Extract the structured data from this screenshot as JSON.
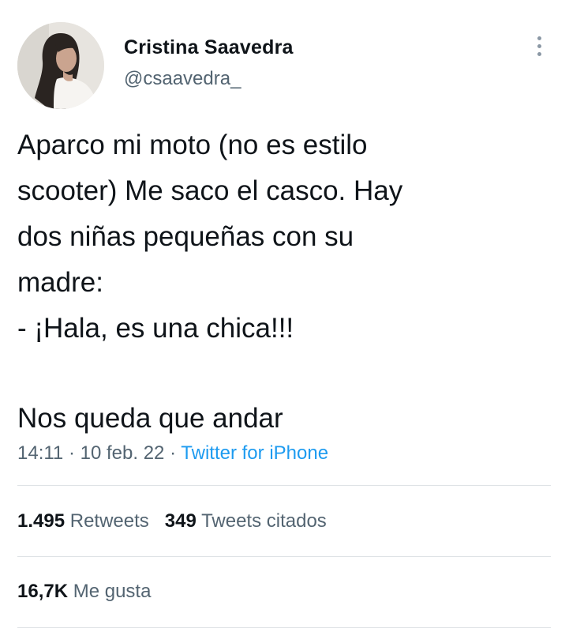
{
  "author": {
    "display_name": "Cristina Saavedra",
    "handle": "@csaavedra_"
  },
  "icons": {
    "avatar": "profile-photo",
    "more": "more-vertical-icon"
  },
  "tweet": {
    "lines": [
      "Aparco mi moto (no es estilo",
      "scooter) Me saco el casco. Hay",
      "dos niñas pequeñas con su",
      "madre:",
      "- ¡Hala, es una chica!!!",
      "Nos queda que andar"
    ]
  },
  "meta": {
    "time": "14:11",
    "separator": "·",
    "date": "10 feb. 22",
    "source": "Twitter for iPhone"
  },
  "stats": {
    "retweets_count": "1.495",
    "retweets_label": "Retweets",
    "quotes_count": "349",
    "quotes_label": "Tweets citados",
    "likes_count": "16,7K",
    "likes_label": "Me gusta"
  },
  "colors": {
    "text": "#0f1419",
    "secondary": "#536471",
    "link": "#1d9bf0",
    "divider": "#dfe3e6"
  }
}
